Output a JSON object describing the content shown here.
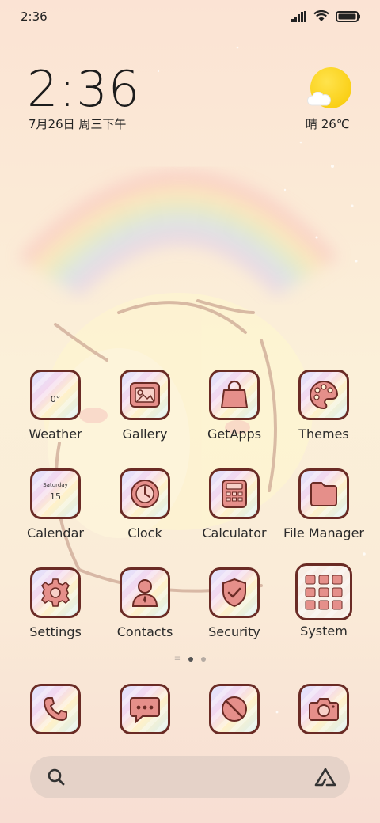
{
  "status": {
    "time": "2:36"
  },
  "clock": {
    "time": "2:36",
    "date": "7月26日 周三下午"
  },
  "weather_widget": {
    "text": "晴 26℃"
  },
  "apps": [
    {
      "label": "Weather",
      "icon": "weather-icon",
      "badge": "0°"
    },
    {
      "label": "Gallery",
      "icon": "gallery-icon"
    },
    {
      "label": "GetApps",
      "icon": "shopping-bag-icon"
    },
    {
      "label": "Themes",
      "icon": "palette-icon"
    },
    {
      "label": "Calendar",
      "icon": "calendar-icon",
      "badge_day": "Saturday",
      "badge_date": "15"
    },
    {
      "label": "Clock",
      "icon": "clock-icon"
    },
    {
      "label": "Calculator",
      "icon": "calculator-icon"
    },
    {
      "label": "File Manager",
      "icon": "folder-icon"
    },
    {
      "label": "Settings",
      "icon": "gear-icon"
    },
    {
      "label": "Contacts",
      "icon": "contact-icon"
    },
    {
      "label": "Security",
      "icon": "shield-check-icon"
    },
    {
      "label": "System",
      "icon": "folder-grid-icon"
    }
  ],
  "dock": [
    {
      "icon": "phone-icon"
    },
    {
      "icon": "message-icon"
    },
    {
      "icon": "browser-icon"
    },
    {
      "icon": "camera-icon"
    }
  ],
  "pager": {
    "pages": 2,
    "active": 1
  },
  "colors": {
    "icon_border": "#6a2b25",
    "icon_fill": "#e58f8a",
    "background": "#fbecd8"
  }
}
